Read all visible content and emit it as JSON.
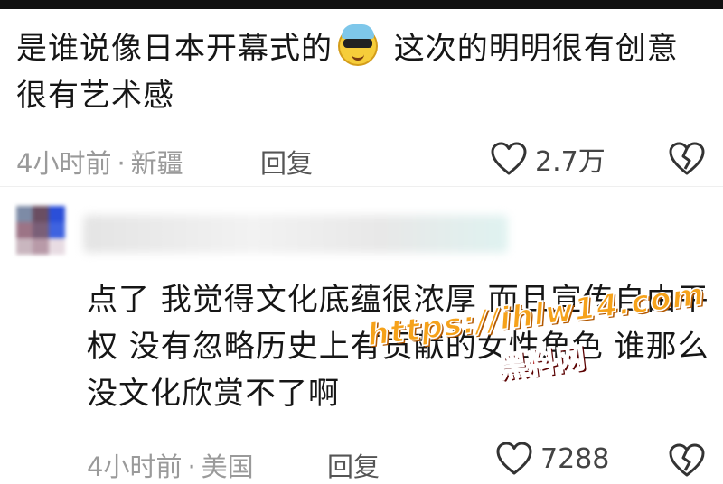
{
  "comments": [
    {
      "text_before_emoji": "是谁说像日本开幕式的",
      "emoji": "cool-sunglasses-emoji",
      "text_after_emoji": " 这次的明明很有创意 很有艺术感",
      "time": "4小时前",
      "location": "新疆",
      "reply_label": "回复",
      "like_count": "2.7万"
    },
    {
      "username_blurred": true,
      "text": "点了 我觉得文化底蕴很浓厚 而且宣传自由平权 没有忽略历史上有贡献的女性角色 谁那么没文化欣赏不了啊",
      "time": "4小时前",
      "location": "美国",
      "reply_label": "回复",
      "like_count": "7288"
    }
  ],
  "watermark": {
    "line1": "https://ihlw14.com",
    "line2": "黑料网"
  },
  "colors": {
    "meta_gray": "#9a9a9a",
    "watermark_orange": "#f6a21a",
    "watermark_red": "#b21414"
  },
  "avatar_pixels": [
    "#7d8ba6",
    "#6a4e62",
    "#2b4fd8",
    "#9c7486",
    "#7a5f78",
    "#3f63e0",
    "#c9b6bf",
    "#b89aa8",
    "#e8dce3"
  ]
}
